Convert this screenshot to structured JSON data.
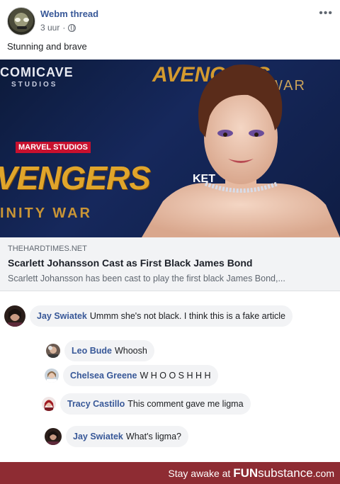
{
  "post": {
    "author": "Webm thread",
    "time": "3 uur",
    "dot": "·",
    "more": "•••",
    "text": "Stunning and brave"
  },
  "link_image": {
    "brand_line1": "COMICAVE",
    "brand_line2": "STUDIOS",
    "marvel": "MARVEL STUDIOS",
    "title": "VENGERS",
    "subtitle": "INITY WAR",
    "top_title": "AVENGERS",
    "top_sub": "WAR",
    "sign": "KET"
  },
  "link": {
    "domain": "THEHARDTIMES.NET",
    "title": "Scarlett Johansson Cast as First Black James Bond",
    "description": "Scarlett Johansson has been cast to play the first black James Bond,..."
  },
  "comments": [
    {
      "name": "Jay Swiatek",
      "text": "Ummm she's not black. I think this is a fake article"
    },
    {
      "name": "Leo Bude",
      "text": "Whoosh"
    },
    {
      "name": "Chelsea Greene",
      "text": "W H O O S H H H"
    },
    {
      "name": "Tracy Castillo",
      "text": "This comment gave me ligma"
    },
    {
      "name": "Jay Swiatek",
      "text": "What's ligma?"
    }
  ],
  "footer": {
    "prefix": "Stay awake at ",
    "brand_fun": "FUN",
    "brand_rest": "substance",
    "suffix": ".com"
  },
  "colors": {
    "link_blue": "#385898",
    "footer_bg": "#8e2c33"
  }
}
